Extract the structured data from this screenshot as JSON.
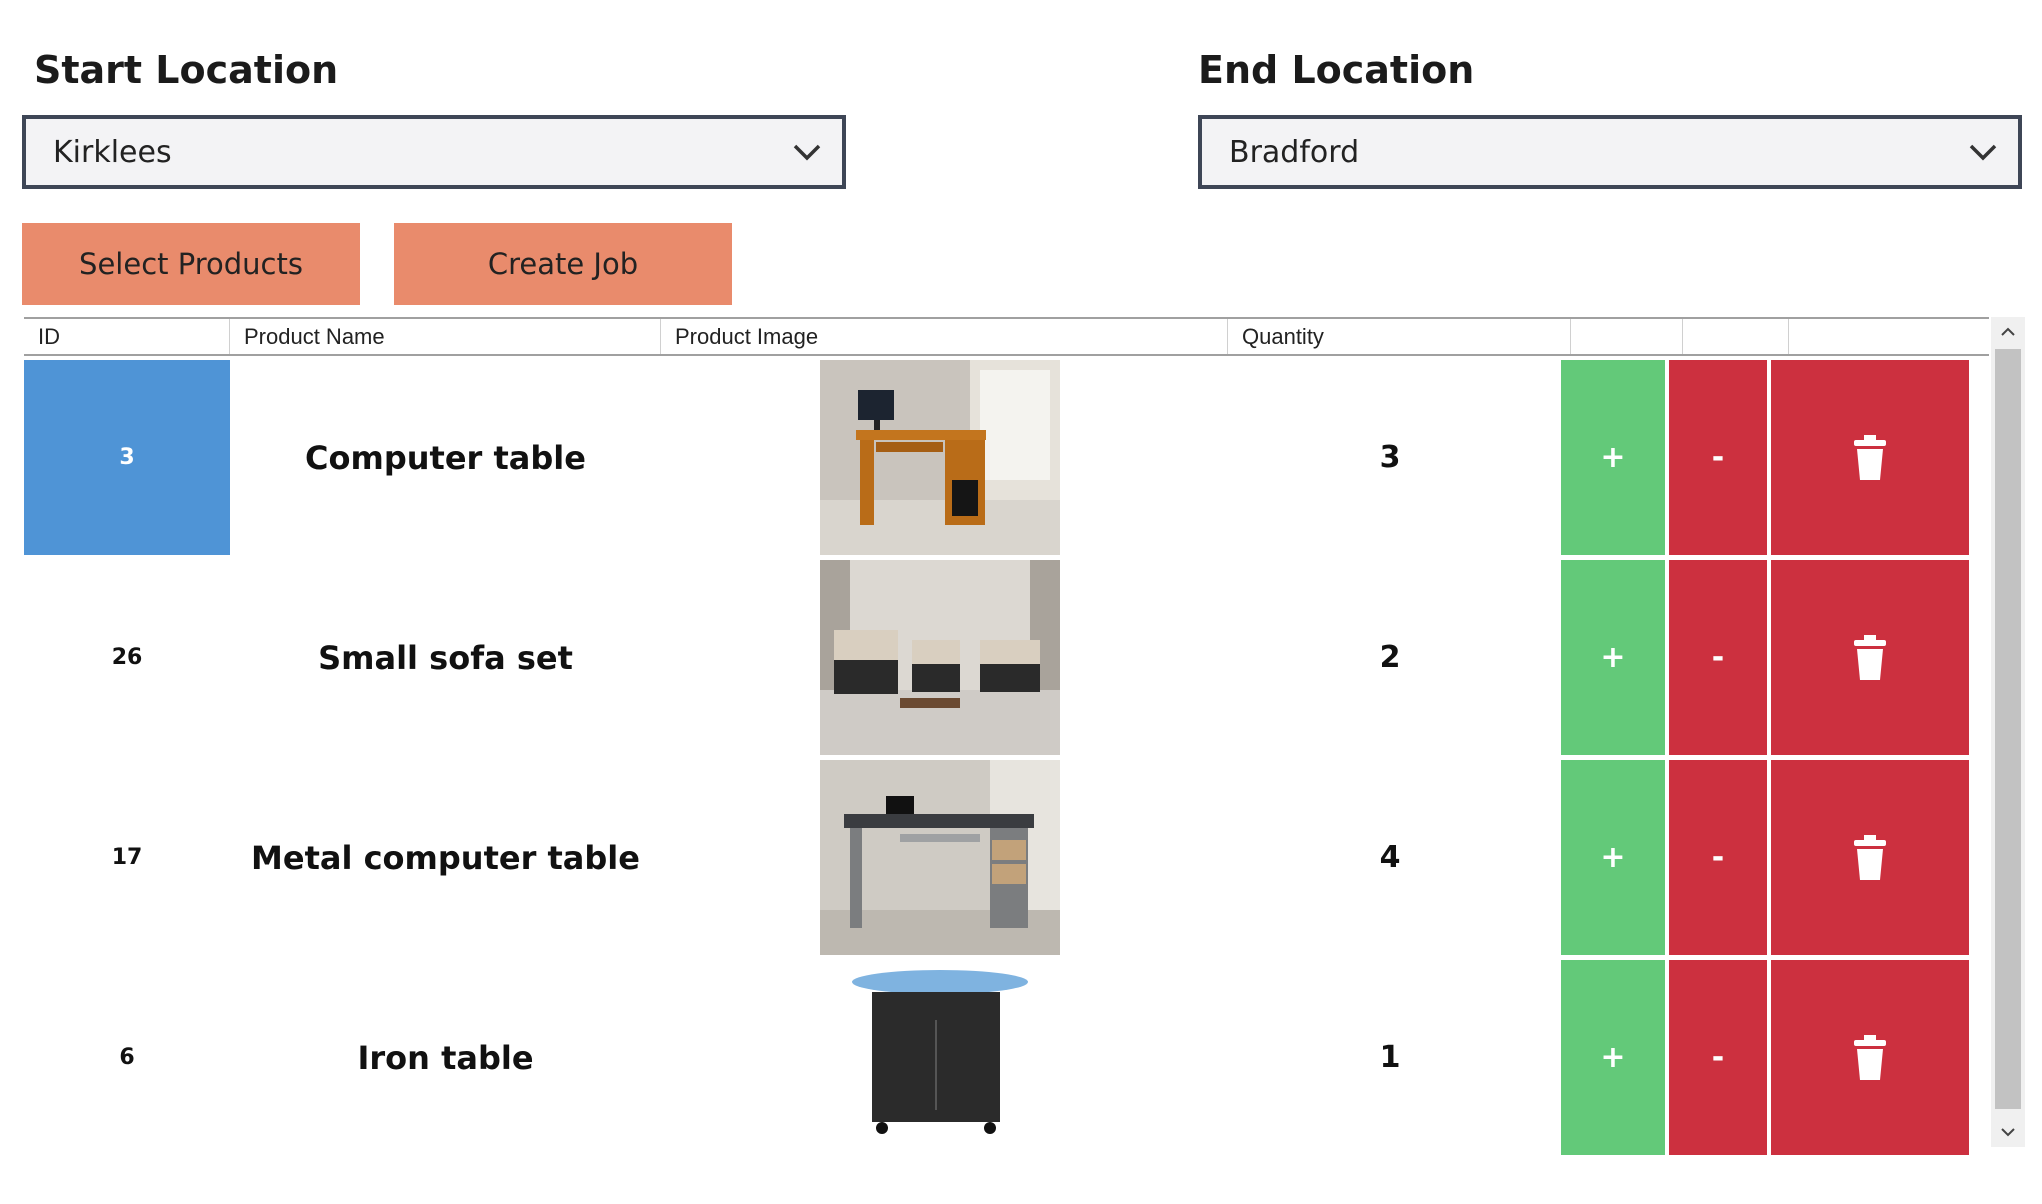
{
  "start_location": {
    "label": "Start Location",
    "value": "Kirklees"
  },
  "end_location": {
    "label": "End Location",
    "value": "Bradford"
  },
  "buttons": {
    "select_products": "Select Products",
    "create_job": "Create Job"
  },
  "table": {
    "headers": [
      "ID",
      "Product Name",
      "Product Image",
      "Quantity",
      "",
      "",
      ""
    ],
    "rows": [
      {
        "id": "3",
        "name": "Computer table",
        "image": "computer-table-image",
        "quantity": "3",
        "selected": true
      },
      {
        "id": "26",
        "name": "Small sofa set",
        "image": "sofa-set-image",
        "quantity": "2",
        "selected": false
      },
      {
        "id": "17",
        "name": "Metal computer table",
        "image": "metal-desk-image",
        "quantity": "4",
        "selected": false
      },
      {
        "id": "6",
        "name": "Iron table",
        "image": "iron-table-image",
        "quantity": "1",
        "selected": false
      }
    ],
    "action_labels": {
      "plus": "+",
      "minus": "-",
      "delete": "trash-icon"
    }
  },
  "colors": {
    "button": "#e98b6c",
    "selected": "#4f94d6",
    "plus": "#63c979",
    "minus": "#cc303f",
    "delete": "#cc303f"
  }
}
